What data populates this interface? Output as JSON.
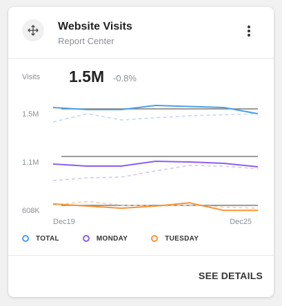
{
  "widget": {
    "title": "Website Visits",
    "subtitle": "Report Center",
    "drag_icon": "move-arrows-icon",
    "menu_icon": "more-vertical-icon"
  },
  "metric": {
    "label": "Visits",
    "value": "1.5M",
    "change": "-0.8%"
  },
  "chart_data": {
    "type": "line",
    "y_tick_labels": [
      "1.5M",
      "1.1M",
      "608K"
    ],
    "x_tick_labels": [
      "Dec19",
      "Dec25"
    ],
    "grid": false,
    "legend_position": "bottom",
    "series": [
      {
        "name": "TOTAL",
        "color": "#4a9fe8",
        "values": [
          1.5,
          1.49,
          1.49,
          1.51,
          1.505,
          1.5,
          1.47
        ]
      },
      {
        "name": "MONDAY",
        "color": "#8b5cf0",
        "values": [
          1.0,
          0.985,
          0.985,
          1.02,
          1.015,
          1.005,
          0.98
        ]
      },
      {
        "name": "TUESDAY",
        "color": "#f59436",
        "values": [
          0.635,
          0.625,
          0.615,
          0.625,
          0.64,
          0.605,
          0.605
        ]
      }
    ],
    "comparison_series": [
      {
        "color": "#c9dbf4",
        "values": [
          1.43,
          1.47,
          1.44,
          1.45,
          1.46,
          1.465,
          1.47
        ]
      },
      {
        "color": "#d8ccf0",
        "values": [
          0.88,
          0.9,
          0.905,
          0.95,
          0.99,
          0.985,
          0.965
        ]
      },
      {
        "color": "#f4cfb0",
        "values": [
          0.63,
          0.645,
          0.63,
          0.625,
          0.63,
          0.62,
          0.615
        ]
      }
    ],
    "reference_lines": [
      1.5,
      1.06,
      0.62
    ]
  },
  "footer": {
    "action_label": "SEE DETAILS"
  },
  "colors": {
    "total": "#4a9fe8",
    "monday": "#8b5cf0",
    "tuesday": "#f59436",
    "reference_line": "#7a7a7a"
  }
}
